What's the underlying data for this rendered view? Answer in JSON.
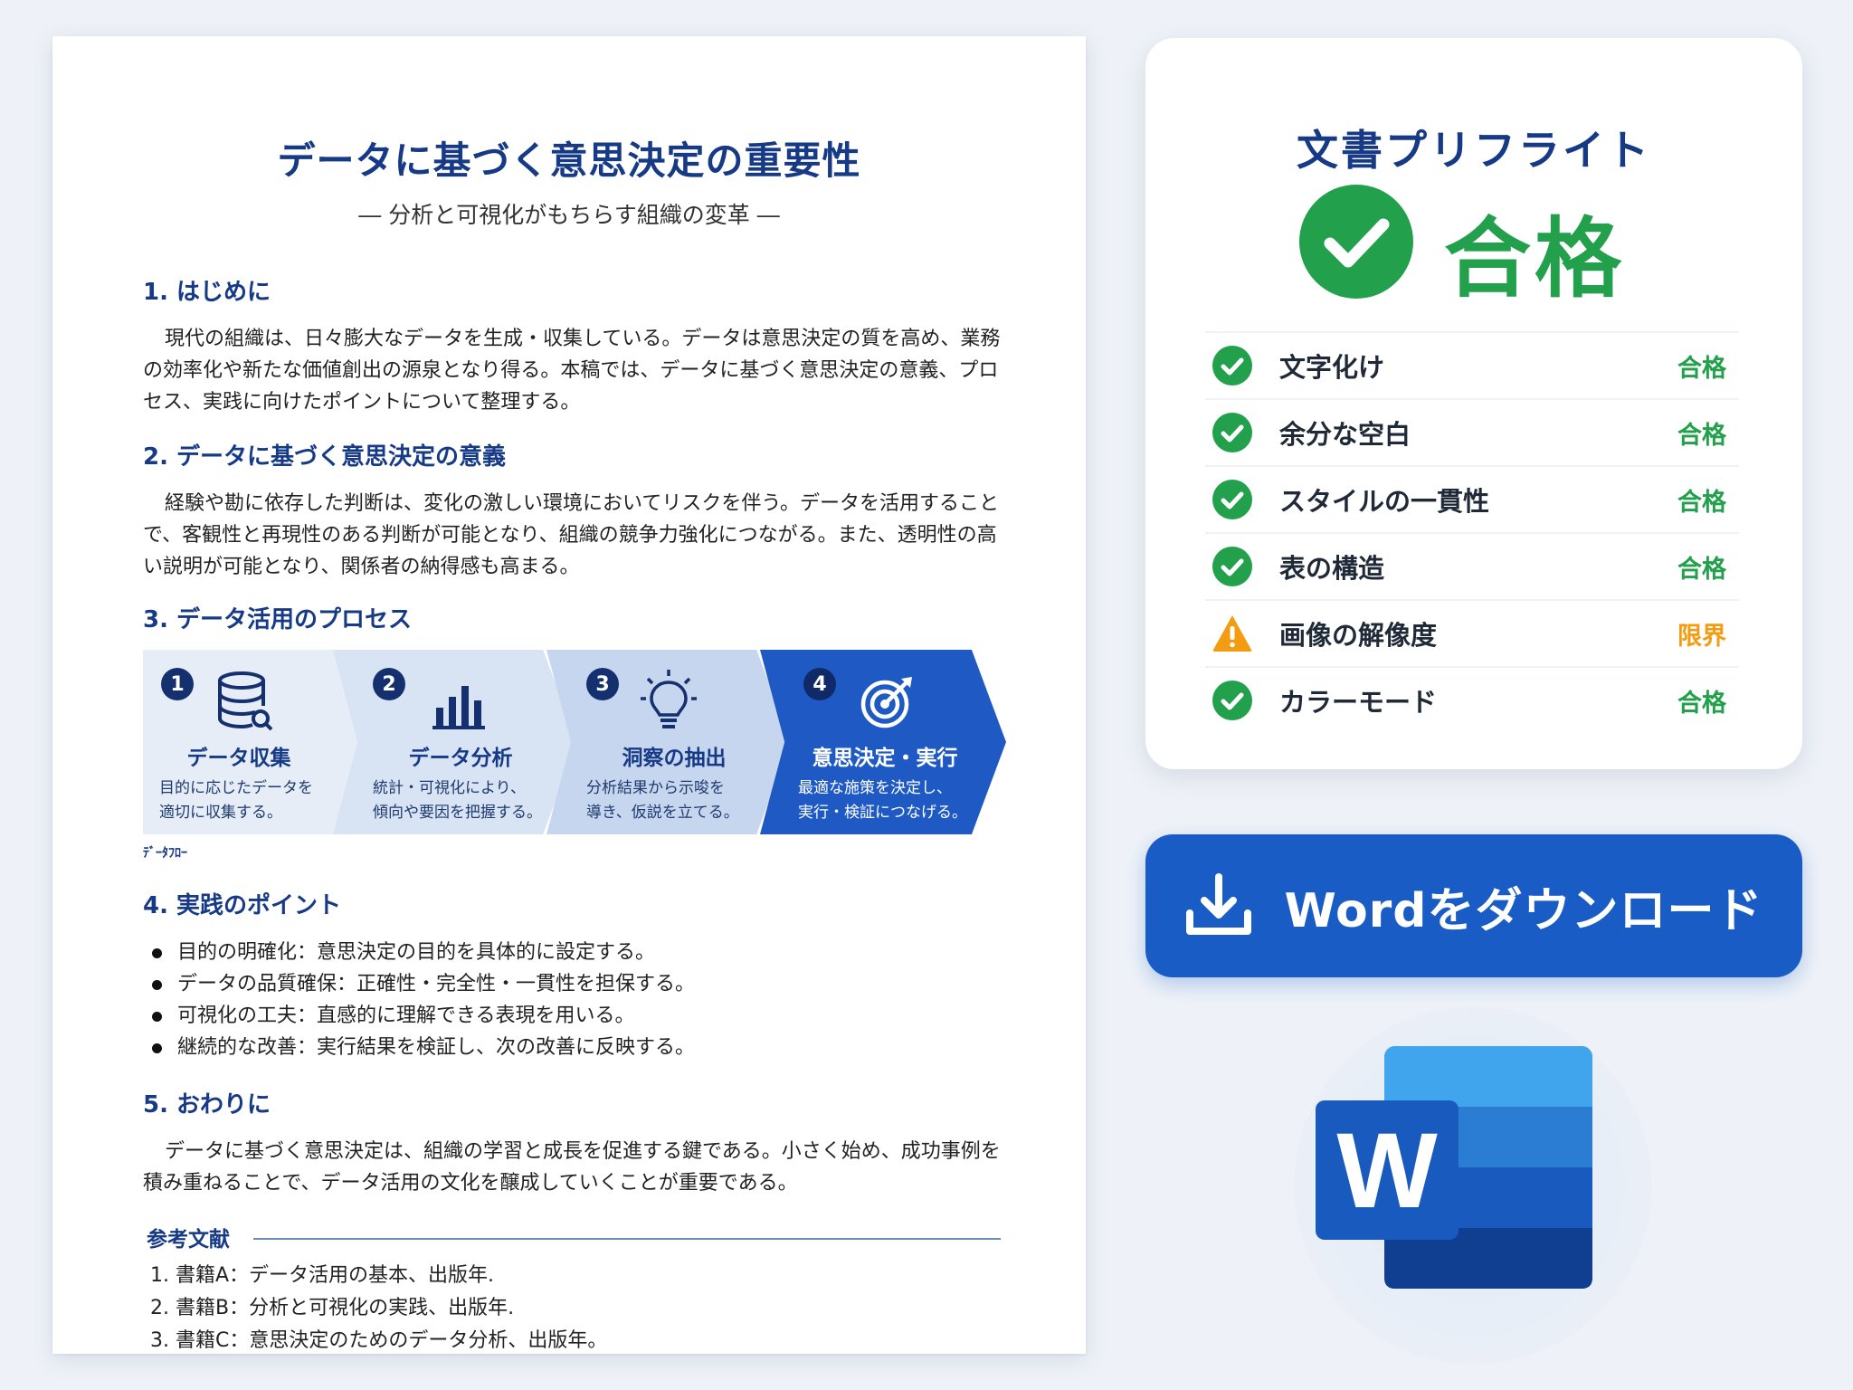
{
  "document": {
    "title": "データに基づく意思決定の重要性",
    "subtitle": "― 分析と可視化がもちらす組織の変革 ―",
    "sections": [
      {
        "heading": "1. はじめに",
        "body": "現代の組織は、日々膨大なデータを生成・収集している。データは意思決定の質を高め、業務の効率化や新たな価値創出の源泉となり得る。本稿では、データに基づく意思決定の意義、プロセス、実践に向けたポイントについて整理する。"
      },
      {
        "heading": "2. データに基づく意思決定の意義",
        "body": "経験や勘に依存した判断は、変化の激しい環境においてリスクを伴う。データを活用することで、客観性と再現性のある判断が可能となり、組織の競争力強化につながる。また、透明性の高い説明が可能となり、関係者の納得感も高まる。"
      },
      {
        "heading": "3. データ活用のプロセス"
      },
      {
        "heading": "4. 実践のポイント",
        "bullets": [
          "目的の明確化：意思決定の目的を具体的に設定する。",
          "データの品質確保：正確性・完全性・一貫性を担保する。",
          "可視化の工夫：直感的に理解できる表現を用いる。",
          "継続的な改善：実行結果を検証し、次の改善に反映する。"
        ]
      },
      {
        "heading": "5. おわりに",
        "body": "データに基づく意思決定は、組織の学習と成長を促進する鍵である。小さく始め、成功事例を積み重ねることで、データ活用の文化を醸成していくことが重要である。"
      }
    ],
    "process": [
      {
        "num": "1",
        "title": "データ収集",
        "desc1": "目的に応じたデータを",
        "desc2": "適切に収集する。",
        "icon": "database-icon"
      },
      {
        "num": "2",
        "title": "データ分析",
        "desc1": "統計・可視化により、",
        "desc2": "傾向や要因を把握する。",
        "icon": "bar-chart-icon"
      },
      {
        "num": "3",
        "title": "洞察の抽出",
        "desc1": "分析結果から示唆を",
        "desc2": "導き、仮説を立てる。",
        "icon": "lightbulb-icon"
      },
      {
        "num": "4",
        "title": "意思決定・実行",
        "desc1": "最適な施策を決定し、",
        "desc2": "実行・検証につなげる。",
        "icon": "target-icon"
      }
    ],
    "process_note": "ﾃﾞｰﾀﾌﾛｰ",
    "references": {
      "heading": "参考文献",
      "items": [
        "1.  書籍A：データ活用の基本、出版年.",
        "2.  書籍B：分析と可視化の実践、出版年.",
        "3.  書籍C：意思決定のためのデータ分析、出版年。"
      ]
    }
  },
  "preflight": {
    "title": "文書プリフライト",
    "verdict": "合格",
    "checks": [
      {
        "label": "文字化け",
        "result": "合格",
        "status": "pass"
      },
      {
        "label": "余分な空白",
        "result": "合格",
        "status": "pass"
      },
      {
        "label": "スタイルの一貫性",
        "result": "合格",
        "status": "pass"
      },
      {
        "label": "表の構造",
        "result": "合格",
        "status": "pass"
      },
      {
        "label": "画像の解像度",
        "result": "限界",
        "status": "warn"
      },
      {
        "label": "カラーモード",
        "result": "合格",
        "status": "pass"
      }
    ]
  },
  "download": {
    "label": "Wordをダウンロード"
  },
  "logo": {
    "letter": "W"
  },
  "colors": {
    "brand": "#163a86",
    "pass": "#22a04b",
    "warn": "#f39c12",
    "button": "#1a5cc6"
  }
}
